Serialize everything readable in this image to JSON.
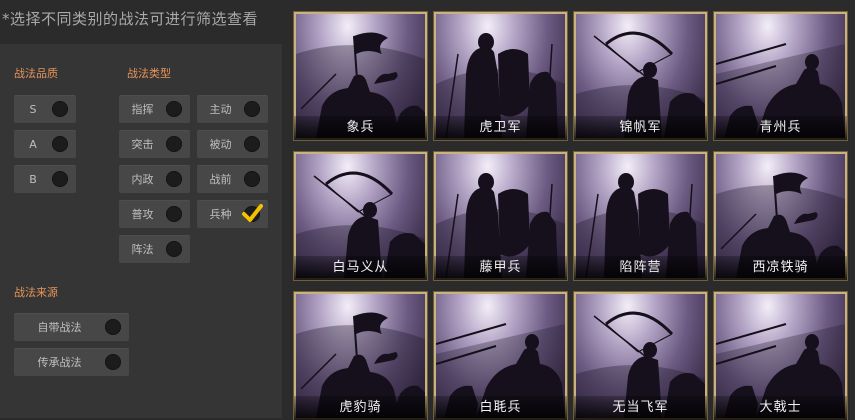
{
  "hint": "*选择不同类别的战法可进行筛选查看",
  "filters": {
    "quality": {
      "title": "战法品质",
      "options": [
        {
          "label": "S",
          "checked": false
        },
        {
          "label": "A",
          "checked": false
        },
        {
          "label": "B",
          "checked": false
        }
      ]
    },
    "type": {
      "title": "战法类型",
      "options": [
        {
          "label": "指挥",
          "checked": false
        },
        {
          "label": "主动",
          "checked": false
        },
        {
          "label": "突击",
          "checked": false
        },
        {
          "label": "被动",
          "checked": false
        },
        {
          "label": "内政",
          "checked": false
        },
        {
          "label": "战前",
          "checked": false
        },
        {
          "label": "普攻",
          "checked": false
        },
        {
          "label": "兵种",
          "checked": true
        },
        {
          "label": "阵法",
          "checked": false
        }
      ]
    },
    "source": {
      "title": "战法来源",
      "options": [
        {
          "label": "自带战法",
          "checked": false
        },
        {
          "label": "传承战法",
          "checked": false
        }
      ]
    }
  },
  "cards": [
    {
      "name": "象兵",
      "art": "cavalry-flag"
    },
    {
      "name": "虎卫军",
      "art": "shield-infantry"
    },
    {
      "name": "锦帆军",
      "art": "archer"
    },
    {
      "name": "青州兵",
      "art": "charging-cavalry"
    },
    {
      "name": "白马义从",
      "art": "archer"
    },
    {
      "name": "藤甲兵",
      "art": "shield-infantry"
    },
    {
      "name": "陷阵营",
      "art": "shield-infantry"
    },
    {
      "name": "西凉铁骑",
      "art": "cavalry-flag"
    },
    {
      "name": "虎豹骑",
      "art": "cavalry-flag"
    },
    {
      "name": "白毦兵",
      "art": "charging-cavalry"
    },
    {
      "name": "无当飞军",
      "art": "archer"
    },
    {
      "name": "大戟士",
      "art": "charging-cavalry"
    }
  ],
  "colors": {
    "accent_title": "#e8945a",
    "check": "#f2c200",
    "card_frame": "#c9b27d"
  }
}
